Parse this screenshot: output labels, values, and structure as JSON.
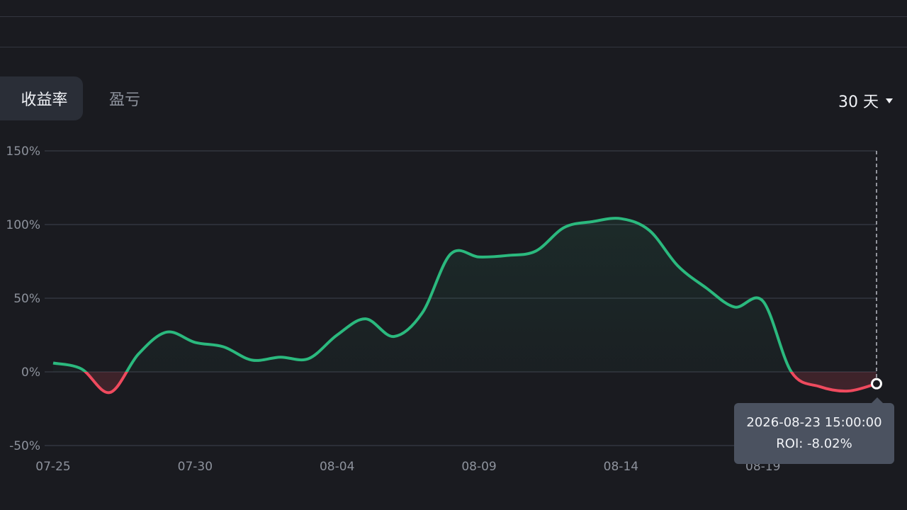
{
  "tabs": [
    {
      "label": "收益率",
      "active": true
    },
    {
      "label": "盈亏",
      "active": false
    }
  ],
  "range": {
    "label": "30 天"
  },
  "tooltip": {
    "time": "2026-08-23 15:00:00",
    "roi": "ROI: -8.02%"
  },
  "colors": {
    "positive": "#2bb97e",
    "negative": "#ef4a5e",
    "grid": "#33363f",
    "tick": "#8d929c"
  },
  "chart_data": {
    "type": "line",
    "ylim": [
      -50,
      150
    ],
    "yticks": [
      {
        "value": 150,
        "label": "150%"
      },
      {
        "value": 100,
        "label": "100%"
      },
      {
        "value": 50,
        "label": "50%"
      },
      {
        "value": 0,
        "label": "0%"
      },
      {
        "value": -50,
        "label": "-50%"
      }
    ],
    "xlim": [
      "07-25",
      "08-23"
    ],
    "xticks": [
      "07-25",
      "07-30",
      "08-04",
      "08-09",
      "08-14",
      "08-19"
    ],
    "series": [
      {
        "x": [
          "07-25",
          "07-26",
          "07-27",
          "07-28",
          "07-29",
          "07-30",
          "07-31",
          "08-01",
          "08-02",
          "08-03",
          "08-04",
          "08-05",
          "08-06",
          "08-07",
          "08-08",
          "08-09",
          "08-10",
          "08-11",
          "08-12",
          "08-13",
          "08-14",
          "08-15",
          "08-16",
          "08-17",
          "08-18",
          "08-19",
          "08-20",
          "08-21",
          "08-22",
          "08-23"
        ],
        "y": [
          6,
          2,
          -14,
          12,
          27,
          20,
          17,
          8,
          10,
          9,
          25,
          36,
          24,
          40,
          80,
          78,
          79,
          82,
          98,
          102,
          104,
          96,
          72,
          57,
          44,
          48,
          0,
          -10,
          -13,
          -8.02
        ]
      }
    ],
    "highlight": {
      "x": "08-23",
      "y": -8.02
    }
  }
}
